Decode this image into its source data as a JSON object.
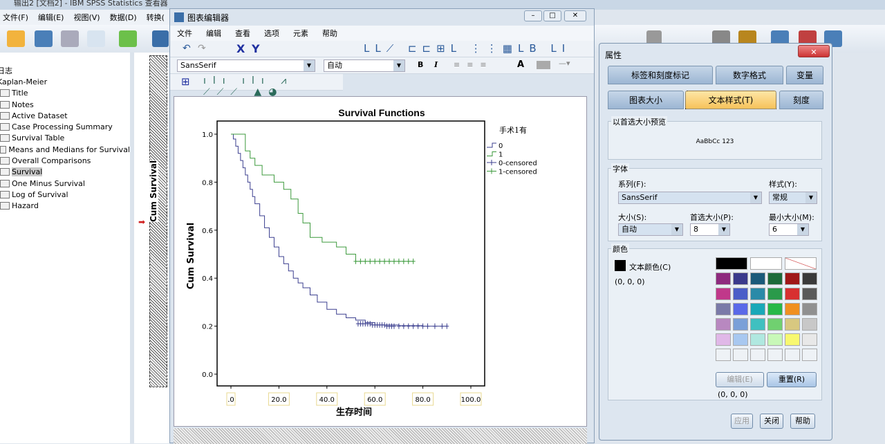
{
  "app": {
    "title": "输出2 [文档2] - IBM SPSS Statistics 查看器",
    "menu": [
      "文件(F)",
      "编辑(E)",
      "视图(V)",
      "数据(D)",
      "转换("
    ]
  },
  "nav": {
    "items": [
      {
        "label": "日志"
      },
      {
        "label": "Kaplan-Meier"
      },
      {
        "label": "Title"
      },
      {
        "label": "Notes"
      },
      {
        "label": "Active Dataset"
      },
      {
        "label": "Case Processing Summary"
      },
      {
        "label": "Survival Table"
      },
      {
        "label": "Means and Medians for Survival"
      },
      {
        "label": "Overall Comparisons"
      },
      {
        "label": "Survival",
        "selected": true
      },
      {
        "label": "One Minus Survival"
      },
      {
        "label": "Log of Survival"
      },
      {
        "label": "Hazard"
      }
    ],
    "preview_label": "Cum Survival"
  },
  "editor": {
    "title": "图表编辑器",
    "menu": [
      "文件",
      "编辑",
      "查看",
      "选项",
      "元素",
      "帮助"
    ],
    "font_value": "SansSerif",
    "size_value": "自动",
    "bold": "B",
    "italic": "I",
    "text_color_btn": "A"
  },
  "chart_data": {
    "type": "line",
    "title": "Survival Functions",
    "xlabel": "生存时间",
    "ylabel": "Cum Survival",
    "xlim": [
      0,
      100
    ],
    "ylim": [
      0,
      1
    ],
    "xticks": [
      ".0",
      "20.0",
      "40.0",
      "60.0",
      "80.0",
      "100.0"
    ],
    "yticks": [
      "0.0",
      "0.2",
      "0.4",
      "0.6",
      "0.8",
      "1.0"
    ],
    "legend": {
      "title": "手术1有",
      "placement": "right",
      "entries": [
        "0",
        "1",
        "0-censored",
        "1-censored"
      ]
    },
    "series": [
      {
        "name": "0",
        "color": "#3b3f8f",
        "step": true,
        "x": [
          0,
          1,
          2,
          3,
          4,
          5,
          6,
          7,
          8,
          9,
          10,
          12,
          14,
          16,
          18,
          20,
          22,
          24,
          26,
          28,
          30,
          33,
          36,
          40,
          44,
          48,
          52,
          56,
          60,
          70,
          80,
          90
        ],
        "y": [
          1,
          0.98,
          0.95,
          0.92,
          0.89,
          0.86,
          0.83,
          0.8,
          0.77,
          0.74,
          0.71,
          0.66,
          0.61,
          0.57,
          0.53,
          0.49,
          0.46,
          0.43,
          0.4,
          0.38,
          0.36,
          0.33,
          0.3,
          0.27,
          0.25,
          0.235,
          0.225,
          0.215,
          0.205,
          0.202,
          0.2,
          0.2
        ]
      },
      {
        "name": "1",
        "color": "#3c9a3c",
        "step": true,
        "x": [
          0,
          5,
          6,
          8,
          10,
          13,
          18,
          22,
          25,
          28,
          30,
          33,
          38,
          44,
          48,
          52,
          76
        ],
        "y": [
          1,
          1,
          0.93,
          0.9,
          0.87,
          0.83,
          0.8,
          0.77,
          0.73,
          0.67,
          0.63,
          0.57,
          0.55,
          0.53,
          0.5,
          0.47,
          0.47
        ]
      }
    ],
    "censored": [
      {
        "name": "0-censored",
        "color": "#3b3f8f",
        "x": [
          53,
          54,
          55,
          56,
          57,
          58,
          59,
          60,
          61,
          62,
          63,
          64,
          65,
          66,
          67,
          68,
          70,
          72,
          74,
          76,
          78,
          80,
          82,
          85,
          88,
          90
        ],
        "y": [
          0.21,
          0.21,
          0.21,
          0.21,
          0.21,
          0.21,
          0.205,
          0.205,
          0.205,
          0.205,
          0.205,
          0.205,
          0.2,
          0.2,
          0.2,
          0.2,
          0.2,
          0.2,
          0.2,
          0.2,
          0.2,
          0.2,
          0.2,
          0.2,
          0.2,
          0.2
        ]
      },
      {
        "name": "1-censored",
        "color": "#3c9a3c",
        "x": [
          52,
          54,
          56,
          58,
          60,
          62,
          64,
          66,
          68,
          70,
          72,
          74,
          76
        ],
        "y": [
          0.47,
          0.47,
          0.47,
          0.47,
          0.47,
          0.47,
          0.47,
          0.47,
          0.47,
          0.47,
          0.47,
          0.47,
          0.47
        ]
      }
    ]
  },
  "props": {
    "title": "属性",
    "tabs_row1": [
      "标签和刻度标记",
      "数字格式",
      "变量"
    ],
    "tabs_row2": [
      "图表大小",
      "文本样式(T)",
      "刻度"
    ],
    "active_tab": "文本样式(T)",
    "preview_group": "以首选大小预览",
    "preview_text": "AaBbCc 123",
    "font_group": "字体",
    "family_label": "系列(F):",
    "family_value": "SansSerif",
    "style_label": "样式(Y):",
    "style_value": "常规",
    "size_label": "大小(S):",
    "size_value": "自动",
    "pref_label": "首选大小(P):",
    "pref_value": "8",
    "min_label": "最小大小(M):",
    "min_value": "6",
    "color_group": "颜色",
    "text_color_label": "文本颜色(C)",
    "text_color_rgb": "(0, 0, 0)",
    "edit_btn": "编辑(E)",
    "reset_btn": "重置(R)",
    "palette_rgb": "(0, 0, 0)",
    "apply": "应用",
    "close": "关闭",
    "help": "帮助",
    "palette": [
      "#000000",
      "#ffffff",
      "none",
      "#8e2a7e",
      "#3a3a8c",
      "#1a5a7a",
      "#1d6b3a",
      "#a01818",
      "#3a3a3a",
      "#c0388a",
      "#4a5ec8",
      "#2a8aa8",
      "#2a9a4a",
      "#d83030",
      "#5a5a5a",
      "#7a7aa8",
      "#5a6ae8",
      "#1aa8b8",
      "#28b848",
      "#f09020",
      "#909090",
      "#b888c0",
      "#7aa0d8",
      "#40c0c0",
      "#70d070",
      "#d8c880",
      "#c8c8c8",
      "#e0b8e8",
      "#a8c8f0",
      "#b0e8e0",
      "#c8f8b8",
      "#f8f870",
      "#e8e8e8"
    ]
  }
}
